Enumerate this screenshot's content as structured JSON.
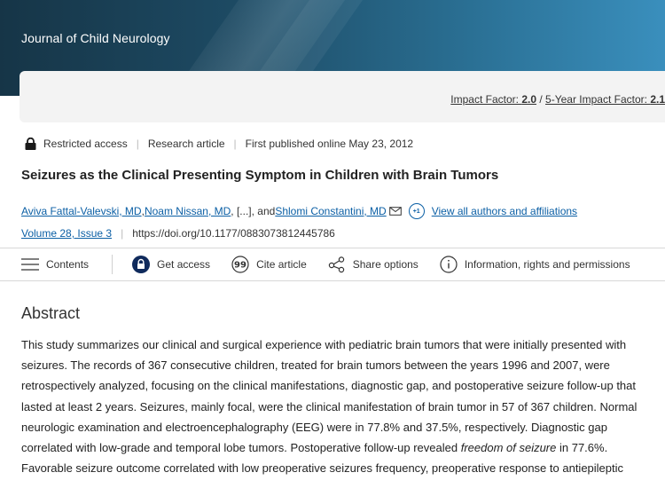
{
  "journal": {
    "title": "Journal of Child Neurology"
  },
  "impact": {
    "label1": "Impact Factor: ",
    "value1": "2.0",
    "divider": " / ",
    "label2": "5-Year Impact Factor: ",
    "value2": "2.1"
  },
  "meta": {
    "access": "Restricted access",
    "type": "Research article",
    "published": "First published online May 23, 2012"
  },
  "article": {
    "title": "Seizures as the Clinical Presenting Symptom in Children with Brain Tumors",
    "authors": [
      "Aviva Fattal-Valevski, MD",
      "Noam Nissan, MD",
      "Shlomi Constantini, MD"
    ],
    "author_sep1": ", ",
    "author_ellipsis": ", [...], and ",
    "more_authors_badge": "+1",
    "view_all": "View all authors and affiliations",
    "volume": "Volume 28, Issue 3",
    "doi": "https://doi.org/10.1177/0883073812445786"
  },
  "toolbar": {
    "contents": "Contents",
    "get_access": "Get access",
    "cite": "Cite article",
    "share": "Share options",
    "info": "Information, rights and permissions"
  },
  "abstract": {
    "heading": "Abstract",
    "text_part1": "This study summarizes our clinical and surgical experience with pediatric brain tumors that were initially presented with seizures. The records of 367 consecutive children, treated for brain tumors between the years 1996 and 2007, were retrospectively analyzed, focusing on the clinical manifestations, diagnostic gap, and postoperative seizure follow-up that lasted at least 2 years. Seizures, mainly focal, were the clinical manifestation of brain tumor in 57 of 367 children. Normal neurologic examination and electroencephalography (EEG) were in 77.8% and 37.5%, respectively. Diagnostic gap correlated with low-grade and temporal lobe tumors. Postoperative follow-up revealed ",
    "text_italic": "freedom of seizure",
    "text_part2": " in 77.6%. Favorable seizure outcome correlated with low preoperative seizures frequency, preoperative response to antiepileptic"
  },
  "icons": {
    "lock": "lock-icon",
    "envelope": "envelope-icon",
    "contents": "hamburger-icon",
    "get_access": "lock-circle-icon",
    "cite": "quote-icon",
    "share": "share-icon",
    "info": "info-icon"
  },
  "colors": {
    "banner_dark": "#163547",
    "banner_light": "#3a8fbd",
    "link": "#0b5fa5"
  }
}
